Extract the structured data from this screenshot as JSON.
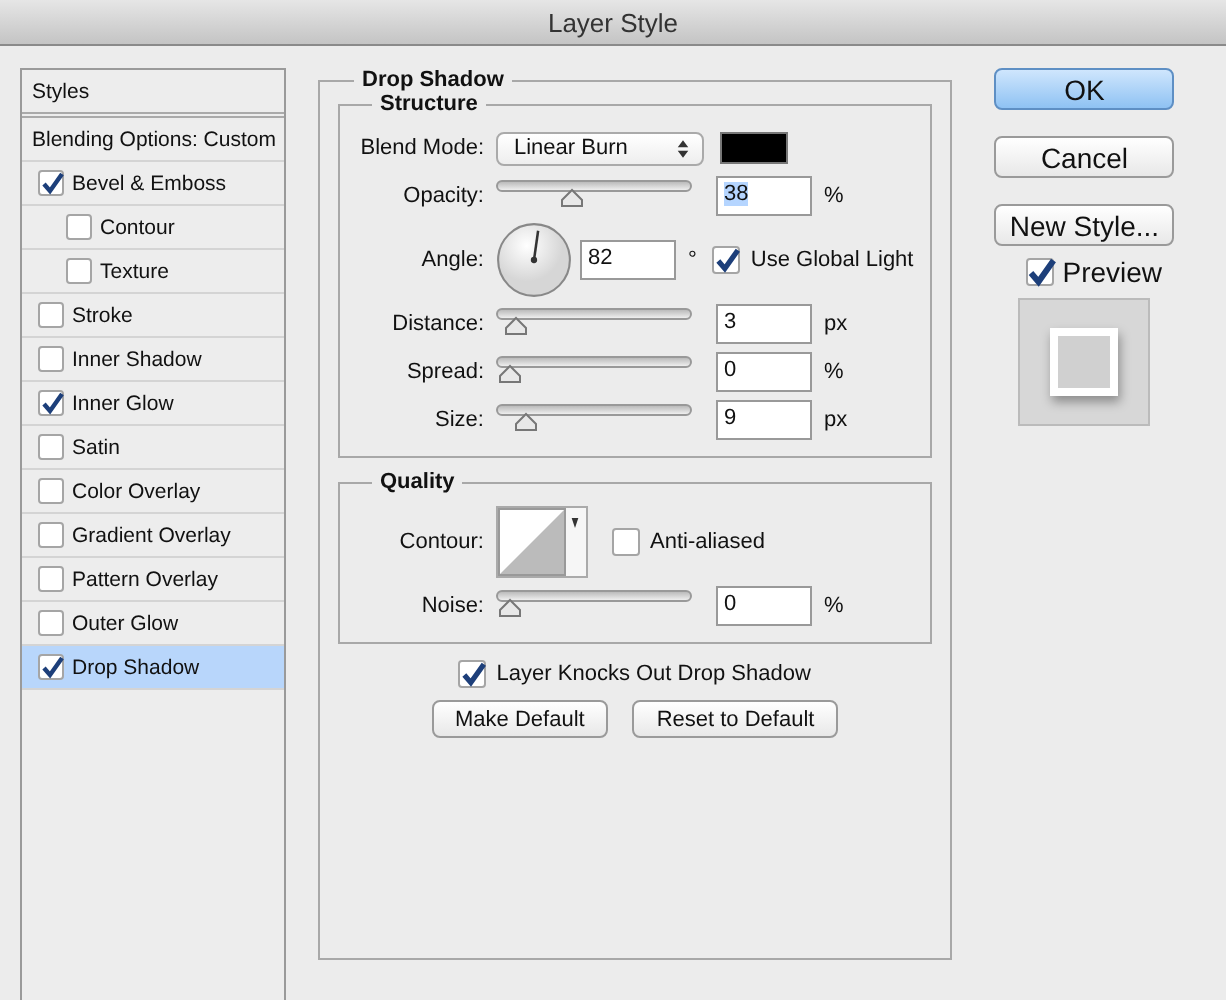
{
  "window": {
    "title": "Layer Style"
  },
  "sidebar": {
    "items": [
      {
        "label": "Styles",
        "kind": "header",
        "selected": false
      },
      {
        "label": "Blending Options: Custom",
        "kind": "header",
        "selected": false
      },
      {
        "label": "Bevel & Emboss",
        "kind": "option",
        "checked": true,
        "selected": false,
        "children": [
          {
            "label": "Contour",
            "kind": "option",
            "checked": false,
            "selected": false
          },
          {
            "label": "Texture",
            "kind": "option",
            "checked": false,
            "selected": false
          }
        ]
      },
      {
        "label": "Stroke",
        "kind": "option",
        "checked": false,
        "selected": false
      },
      {
        "label": "Inner Shadow",
        "kind": "option",
        "checked": false,
        "selected": false
      },
      {
        "label": "Inner Glow",
        "kind": "option",
        "checked": true,
        "selected": false
      },
      {
        "label": "Satin",
        "kind": "option",
        "checked": false,
        "selected": false
      },
      {
        "label": "Color Overlay",
        "kind": "option",
        "checked": false,
        "selected": false
      },
      {
        "label": "Gradient Overlay",
        "kind": "option",
        "checked": false,
        "selected": false
      },
      {
        "label": "Pattern Overlay",
        "kind": "option",
        "checked": false,
        "selected": false
      },
      {
        "label": "Outer Glow",
        "kind": "option",
        "checked": false,
        "selected": false
      },
      {
        "label": "Drop Shadow",
        "kind": "option",
        "checked": true,
        "selected": true
      }
    ]
  },
  "panel": {
    "title": "Drop Shadow",
    "structure": {
      "title": "Structure",
      "rows": [
        {
          "kind": "blend",
          "label": "Blend Mode:",
          "value": "Linear Burn",
          "color": "#000000"
        },
        {
          "kind": "slider",
          "label": "Opacity:",
          "level": 0.36,
          "value": "38",
          "unit": "%",
          "highlighted": true
        },
        {
          "kind": "angle",
          "label": "Angle:",
          "value": "82",
          "unit": "°",
          "check_label": "Use Global Light",
          "checked": true
        },
        {
          "kind": "slider",
          "label": "Distance:",
          "level": 0.03,
          "value": "3",
          "unit": "px",
          "highlighted": false
        },
        {
          "kind": "slider",
          "label": "Spread:",
          "level": 0,
          "value": "0",
          "unit": "%",
          "highlighted": false
        },
        {
          "kind": "slider",
          "label": "Size:",
          "level": 0.09,
          "value": "9",
          "unit": "px",
          "highlighted": false
        }
      ]
    },
    "quality": {
      "title": "Quality",
      "rows": [
        {
          "kind": "contour",
          "label": "Contour:",
          "check_label": "Anti-aliased",
          "checked": false
        },
        {
          "kind": "slider",
          "label": "Noise:",
          "level": 0,
          "value": "0",
          "unit": "%",
          "highlighted": false
        }
      ]
    },
    "knockout": {
      "label": "Layer Knocks Out Drop Shadow",
      "checked": true
    },
    "buttons": [
      "Make Default",
      "Reset to Default"
    ]
  },
  "actions": {
    "buttons": [
      {
        "label": "OK",
        "default": true
      },
      {
        "label": "Cancel",
        "default": false
      },
      {
        "label": "New Style...",
        "default": false
      }
    ],
    "preview": {
      "label": "Preview",
      "checked": true
    }
  }
}
